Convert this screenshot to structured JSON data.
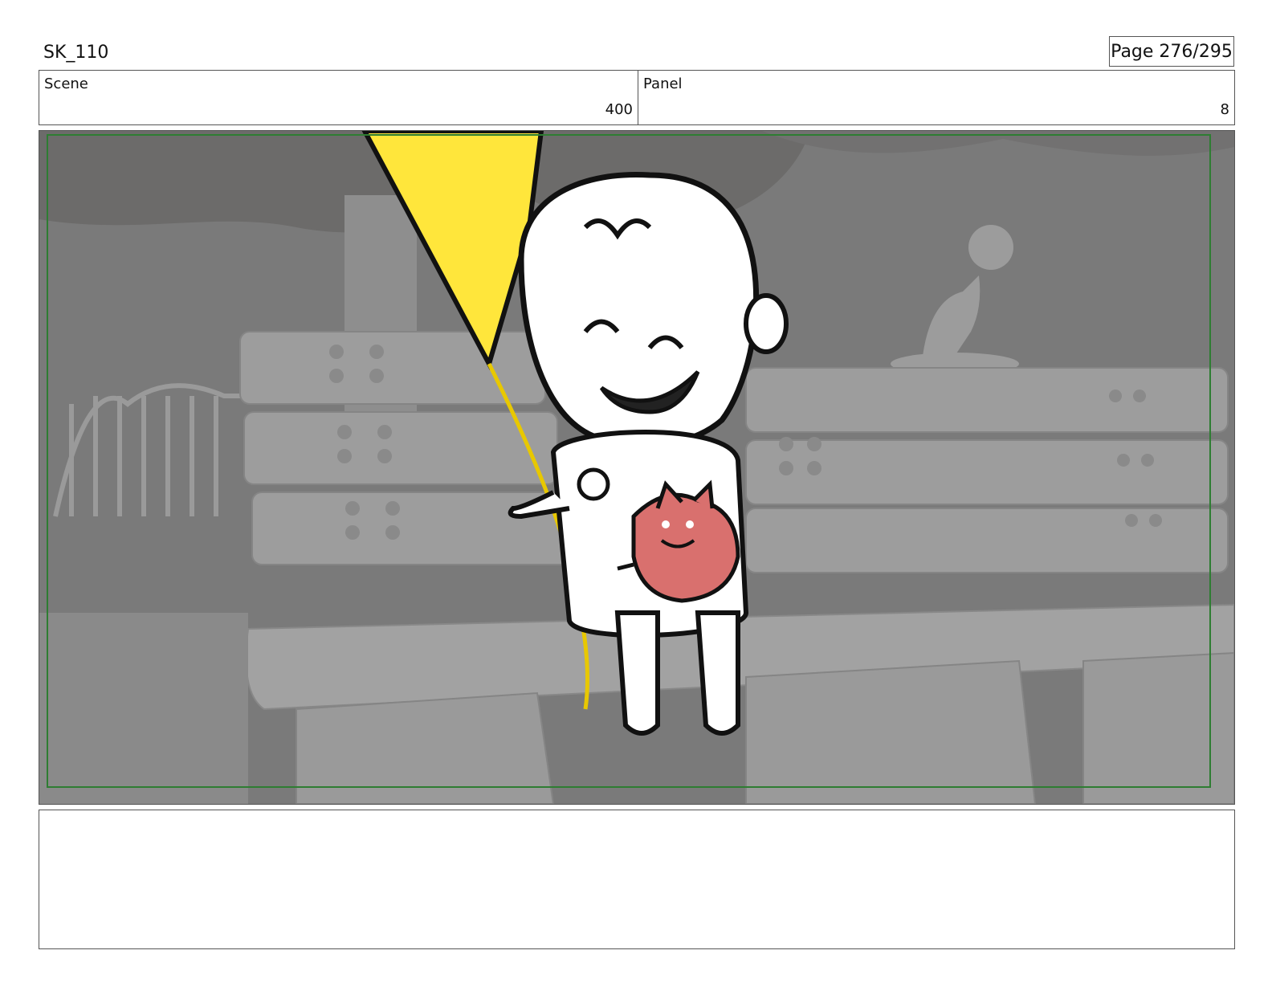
{
  "header": {
    "title": "SK_110",
    "page": "Page 276/295"
  },
  "info": {
    "scene_label": "Scene",
    "scene_value": "400",
    "panel_label": "Panel",
    "panel_value": "8"
  },
  "colors": {
    "safe_frame": "#2e7d32",
    "balloon": "#ffe63b",
    "cat_toy": "#d9706e",
    "background_gray": "#7c7c7c"
  }
}
